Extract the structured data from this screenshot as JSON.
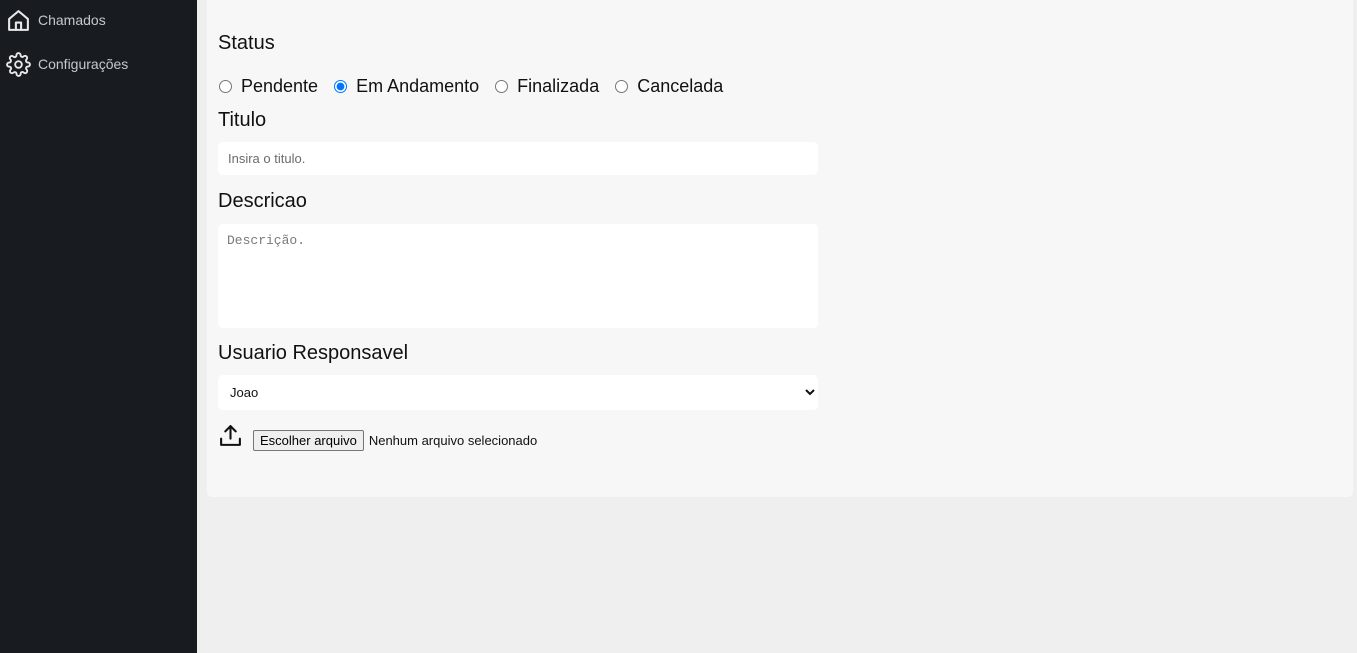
{
  "sidebar": {
    "items": [
      {
        "label": "Chamados",
        "icon": "home-icon"
      },
      {
        "label": "Configurações",
        "icon": "gear-icon"
      }
    ]
  },
  "form": {
    "status_label": "Status",
    "status_options": [
      {
        "label": "Pendente",
        "checked": false
      },
      {
        "label": "Em Andamento",
        "checked": true
      },
      {
        "label": "Finalizada",
        "checked": false
      },
      {
        "label": "Cancelada",
        "checked": false
      }
    ],
    "title_label": "Titulo",
    "title_placeholder": "Insira o titulo.",
    "description_label": "Descricao",
    "description_placeholder": "Descrição.",
    "user_label": "Usuario Responsavel",
    "user_selected": "Joao",
    "upload_icon": "upload-icon",
    "file_button_label": "Escolher arquivo",
    "file_status": "Nenhum arquivo selecionado"
  },
  "colors": {
    "sidebar_bg": "#181c20",
    "panel_bg": "#f7f7f7",
    "page_bg": "#efefef",
    "accent": "#0b6bd3"
  }
}
